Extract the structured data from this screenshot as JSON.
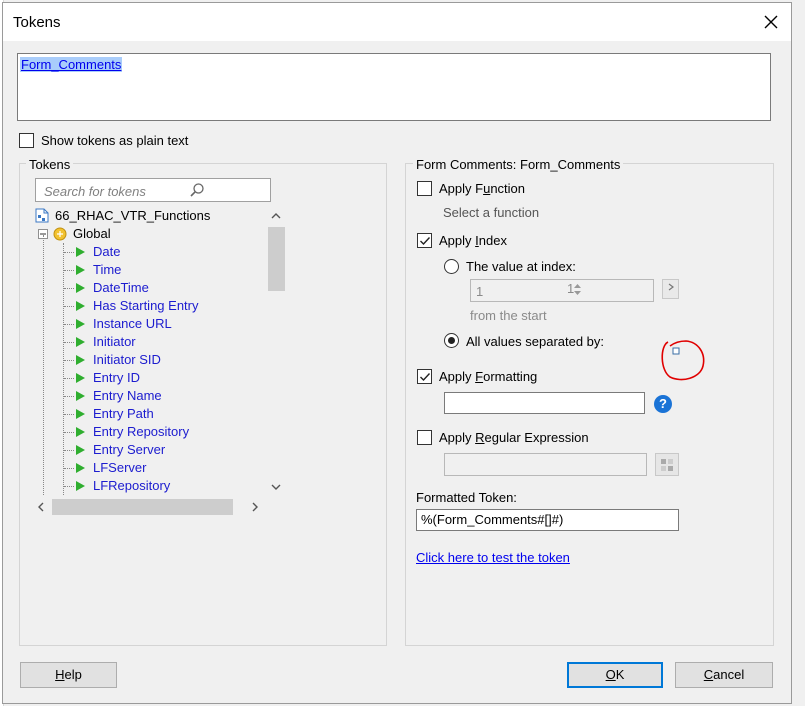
{
  "window": {
    "title": "Tokens"
  },
  "token_text": "Form_Comments",
  "show_plain_text": {
    "label": "Show tokens as plain text",
    "checked": false
  },
  "tokens_panel": {
    "title": "Tokens",
    "search_placeholder": "Search for tokens",
    "root": "66_RHAC_VTR_Functions",
    "group": "Global",
    "items": [
      "Date",
      "Time",
      "DateTime",
      "Has Starting Entry",
      "Instance URL",
      "Initiator",
      "Initiator SID",
      "Entry ID",
      "Entry Name",
      "Entry Path",
      "Entry Repository",
      "Entry Server",
      "LFServer",
      "LFRepository"
    ]
  },
  "right_panel": {
    "title": "Form Comments: Form_Comments",
    "apply_function": {
      "label_pre": "Apply F",
      "label_key": "u",
      "label_post": "nction",
      "checked": false,
      "placeholder": "Select a function"
    },
    "apply_index": {
      "label_pre": "Apply ",
      "label_key": "I",
      "label_post": "ndex",
      "checked": true,
      "value_at_index": {
        "label": "The value at index:",
        "selected": false
      },
      "index_value": "1",
      "index_value_right": "1",
      "from_text": "from the  start",
      "all_values": {
        "label": "All values separated by:",
        "selected": true
      }
    },
    "apply_formatting": {
      "label_pre": "Apply ",
      "label_key": "F",
      "label_post": "ormatting",
      "checked": true,
      "value": ""
    },
    "apply_regex": {
      "label_pre": "Apply ",
      "label_key": "R",
      "label_post": "egular Expression",
      "checked": false,
      "value": ""
    },
    "formatted_token": {
      "label": "Formatted Token:",
      "value": "%(Form_Comments#[]#)"
    },
    "test_link": "Click here to test the token"
  },
  "buttons": {
    "help_key": "H",
    "help_rest": "elp",
    "ok_key": "O",
    "ok_rest": "K",
    "cancel_key": "C",
    "cancel_rest": "ancel"
  },
  "colors": {
    "link": "#0000ee",
    "tree_text": "#1c1ccf",
    "annotation": "#e00000",
    "help_icon": "#1a73d6"
  }
}
